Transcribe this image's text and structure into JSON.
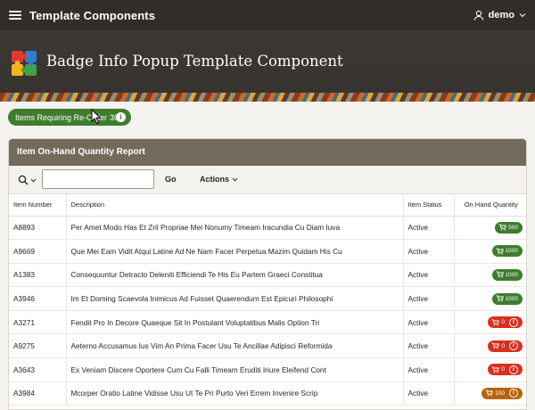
{
  "topbar": {
    "title": "Template Components",
    "user": "demo"
  },
  "hero": {
    "title": "Badge Info Popup Template Component"
  },
  "badge_button": {
    "label": "Items Requiring Re-Order",
    "count": "30",
    "icon": "info-icon"
  },
  "report": {
    "title": "Item On-Hand Quantity Report",
    "toolbar": {
      "search_value": "",
      "go_label": "Go",
      "actions_label": "Actions"
    },
    "columns": [
      "Item Number",
      "Description",
      "Item Status",
      "On Hand Quantity"
    ],
    "rows": [
      {
        "item": "A8893",
        "description": "Per Amet Modo Has Et Zril Propriae Mei Nonumy Timeam Iracundia Cu Diam Iuva",
        "status": "Active",
        "qty": "500",
        "level": "ok",
        "color": "#3f7c2d"
      },
      {
        "item": "A9669",
        "description": "Que Mei Eam Vidit Atqui Latine Ad Ne Nam Facer Perpetua Mazim Quidam His Cu",
        "status": "Active",
        "qty": "1000",
        "level": "ok",
        "color": "#3f7c2d"
      },
      {
        "item": "A1383",
        "description": "Consequuntur Detracto Deleniti Efficiendi Te His Eu Partem Graeci Constitua",
        "status": "Active",
        "qty": "1000",
        "level": "ok",
        "color": "#3f7c2d"
      },
      {
        "item": "A3946",
        "description": "Im Et Doming Scaevola Inimicus Ad Fuisset Quaerendum Est Epicuri Philosophi",
        "status": "Active",
        "qty": "1000",
        "level": "ok",
        "color": "#3f7c2d"
      },
      {
        "item": "A3271",
        "description": "Fendit Pro In Decore Quaeque Sit In Postulant Voluptatibus Malis Option Tri",
        "status": "Active",
        "qty": "0",
        "level": "critical",
        "color": "#d7301f"
      },
      {
        "item": "A9275",
        "description": "Aeterno Accusamus Ius Vim An Prima Facer Usu Te Ancillae Adipisci Reformida",
        "status": "Active",
        "qty": "0",
        "level": "critical",
        "color": "#d7301f"
      },
      {
        "item": "A3643",
        "description": "Ex Veniam Discere Oportere Cum Cu Falli Timeam Eruditi Iriure Eleifend Cont",
        "status": "Active",
        "qty": "0",
        "level": "critical",
        "color": "#d7301f"
      },
      {
        "item": "A3984",
        "description": "Mcorper Oratio Latine Vidisse Usu Ut Te Pri Purto Veri Errem Invenire Scrip",
        "status": "Active",
        "qty": "100",
        "level": "warning",
        "color": "#b8620d"
      }
    ]
  }
}
